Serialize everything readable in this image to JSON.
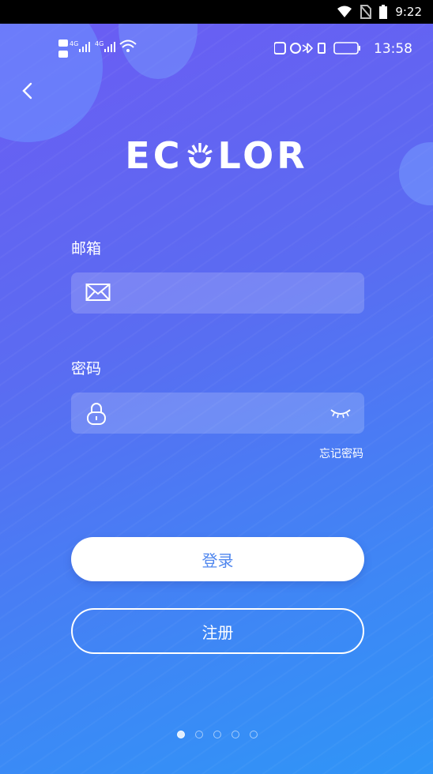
{
  "system_status": {
    "time": "9:22"
  },
  "inner_status": {
    "network": "HD1 HD2 4G 4G",
    "battery": "100",
    "time": "13:58"
  },
  "brand": {
    "logo_text_left": "EC",
    "logo_text_right": "LOR"
  },
  "form": {
    "email_label": "邮箱",
    "email_value": "",
    "password_label": "密码",
    "password_value": "",
    "forgot_password": "忘记密码"
  },
  "actions": {
    "login_label": "登录",
    "register_label": "注册"
  },
  "pager": {
    "pages": 5,
    "active": 0
  },
  "colors": {
    "gradient_top": "#6b5cf3",
    "gradient_bottom": "#2f95f7",
    "login_text": "#4f86ee"
  }
}
